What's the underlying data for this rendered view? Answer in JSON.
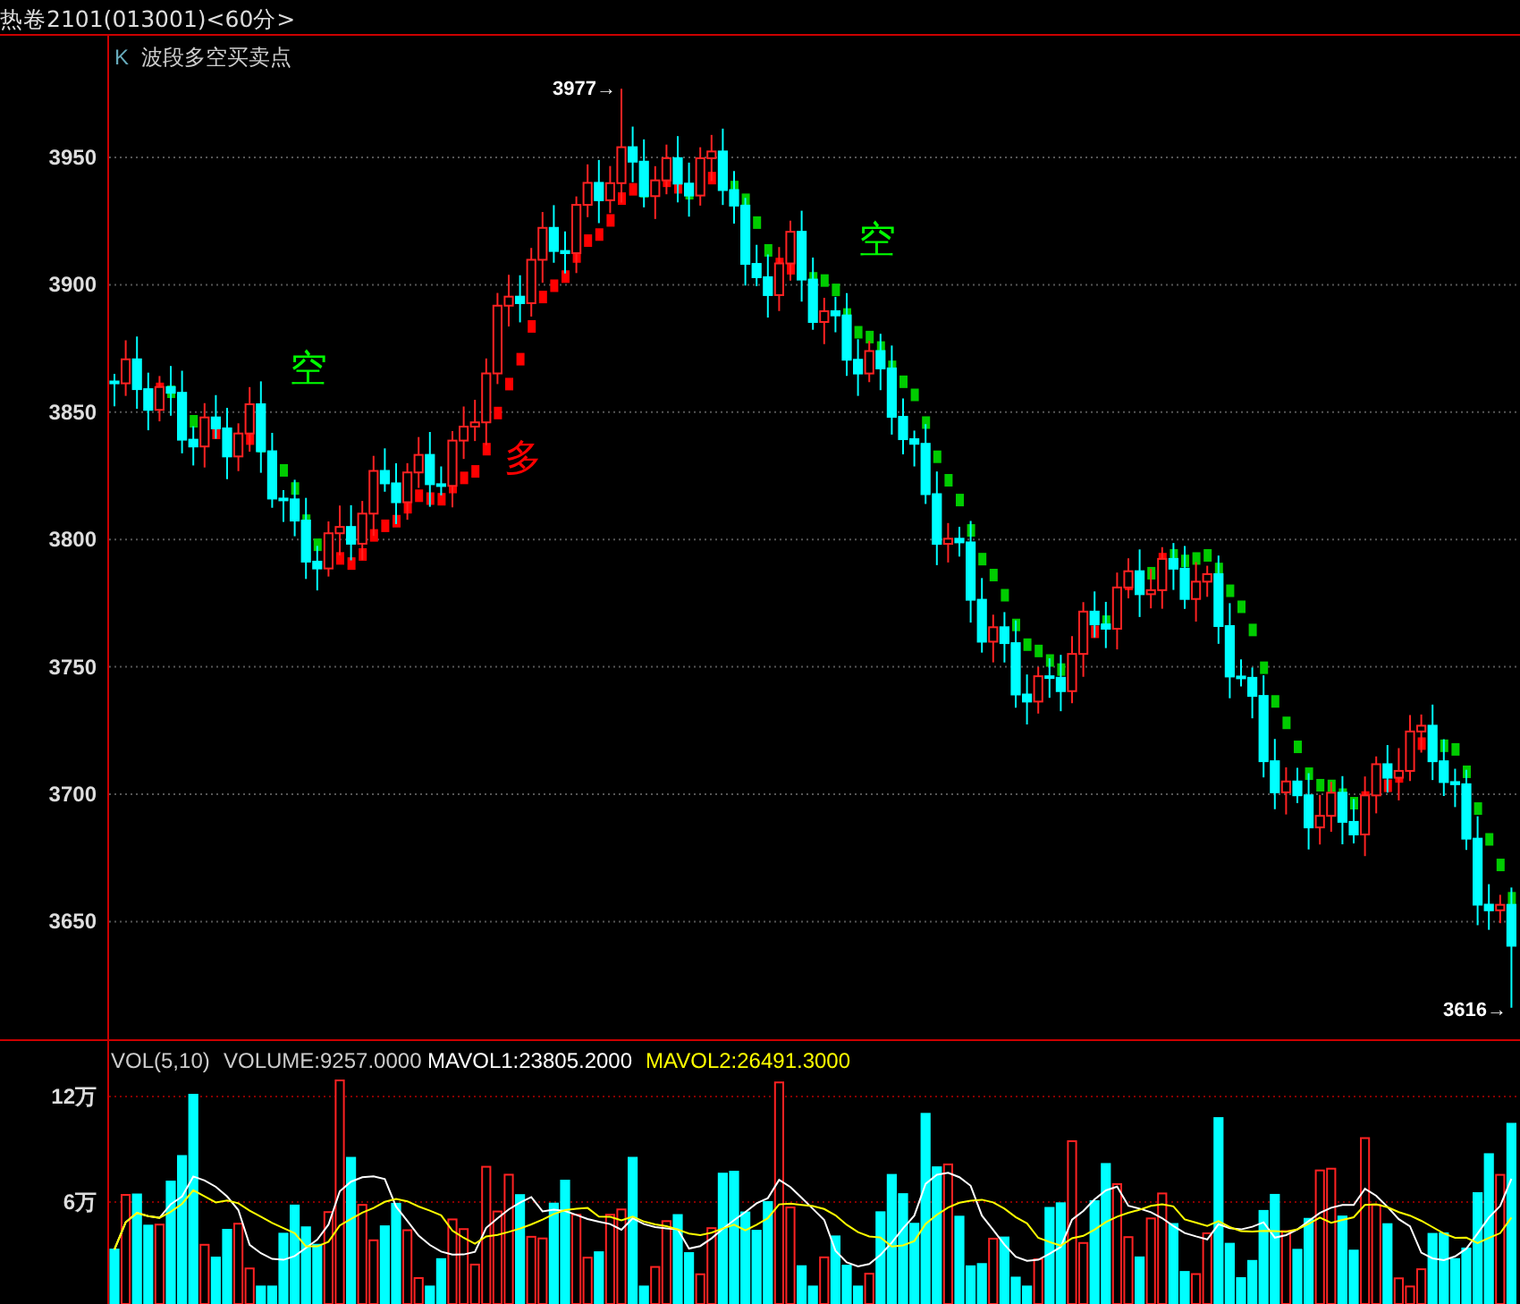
{
  "title": "热卷2101(013001)<60分>",
  "price_panel": {
    "indicator_marker": "K",
    "indicator_name": "波段多空买卖点",
    "yticks": [
      "3950",
      "3900",
      "3850",
      "3800",
      "3750",
      "3700",
      "3650"
    ],
    "high_label": "3977→",
    "low_label": "3616→",
    "signals": [
      {
        "text": "空",
        "kind": "short"
      },
      {
        "text": "多",
        "kind": "long"
      },
      {
        "text": "空",
        "kind": "short"
      }
    ]
  },
  "volume_panel": {
    "name": "VOL(5,10)",
    "volume": "VOLUME:9257.0000",
    "mavol1": "MAVOL1:23805.2000",
    "mavol2": "MAVOL2:26491.3000",
    "yticks": [
      "12万",
      "6万"
    ]
  }
}
